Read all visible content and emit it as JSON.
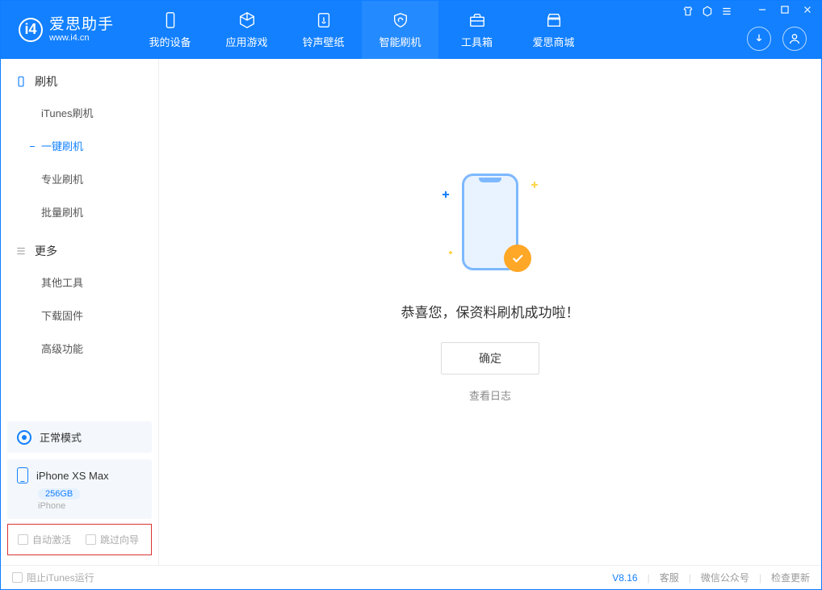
{
  "app": {
    "title": "爱思助手",
    "url": "www.i4.cn"
  },
  "nav": {
    "tabs": [
      {
        "label": "我的设备"
      },
      {
        "label": "应用游戏"
      },
      {
        "label": "铃声壁纸"
      },
      {
        "label": "智能刷机"
      },
      {
        "label": "工具箱"
      },
      {
        "label": "爱思商城"
      }
    ]
  },
  "sidebar": {
    "group1": {
      "title": "刷机",
      "items": [
        "iTunes刷机",
        "一键刷机",
        "专业刷机",
        "批量刷机"
      ]
    },
    "group2": {
      "title": "更多",
      "items": [
        "其他工具",
        "下载固件",
        "高级功能"
      ]
    },
    "mode": "正常模式",
    "device": {
      "name": "iPhone XS Max",
      "capacity": "256GB",
      "type": "iPhone"
    },
    "checks": {
      "auto_activate": "自动激活",
      "skip_wizard": "跳过向导"
    }
  },
  "main": {
    "message": "恭喜您，保资料刷机成功啦！",
    "ok": "确定",
    "view_log": "查看日志"
  },
  "footer": {
    "block_itunes": "阻止iTunes运行",
    "version": "V8.16",
    "links": [
      "客服",
      "微信公众号",
      "检查更新"
    ]
  }
}
